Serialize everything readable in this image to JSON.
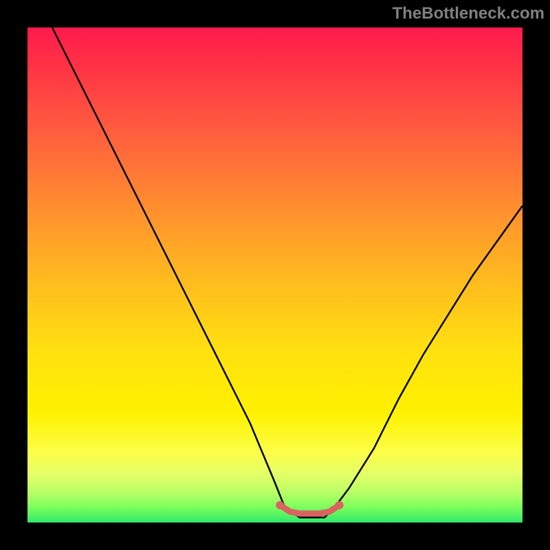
{
  "watermark": "TheBottleneck.com",
  "chart_data": {
    "type": "line",
    "title": "",
    "xlabel": "",
    "ylabel": "",
    "xlim": [
      0,
      100
    ],
    "ylim": [
      0,
      100
    ],
    "background_gradient": {
      "top": "#ff1a4d",
      "bottom": "#30e86b",
      "meaning": "bottleneck-severity-heatmap"
    },
    "series": [
      {
        "name": "bottleneck-curve",
        "x": [
          5,
          10,
          15,
          20,
          25,
          30,
          35,
          40,
          45,
          50,
          52,
          55,
          58,
          60,
          62,
          65,
          70,
          75,
          80,
          85,
          90,
          95,
          100
        ],
        "y": [
          100,
          90,
          80,
          70,
          60,
          50,
          40,
          30,
          20,
          8,
          3,
          1,
          1,
          1,
          3,
          7,
          15,
          25,
          34,
          42,
          50,
          57,
          64
        ],
        "color": "#000000"
      },
      {
        "name": "optimal-zone-marker",
        "x": [
          51,
          53,
          55,
          57,
          59,
          61,
          63
        ],
        "y": [
          3.5,
          2.2,
          1.8,
          1.8,
          1.8,
          2.2,
          3.5
        ],
        "color": "#d9645f"
      }
    ]
  }
}
